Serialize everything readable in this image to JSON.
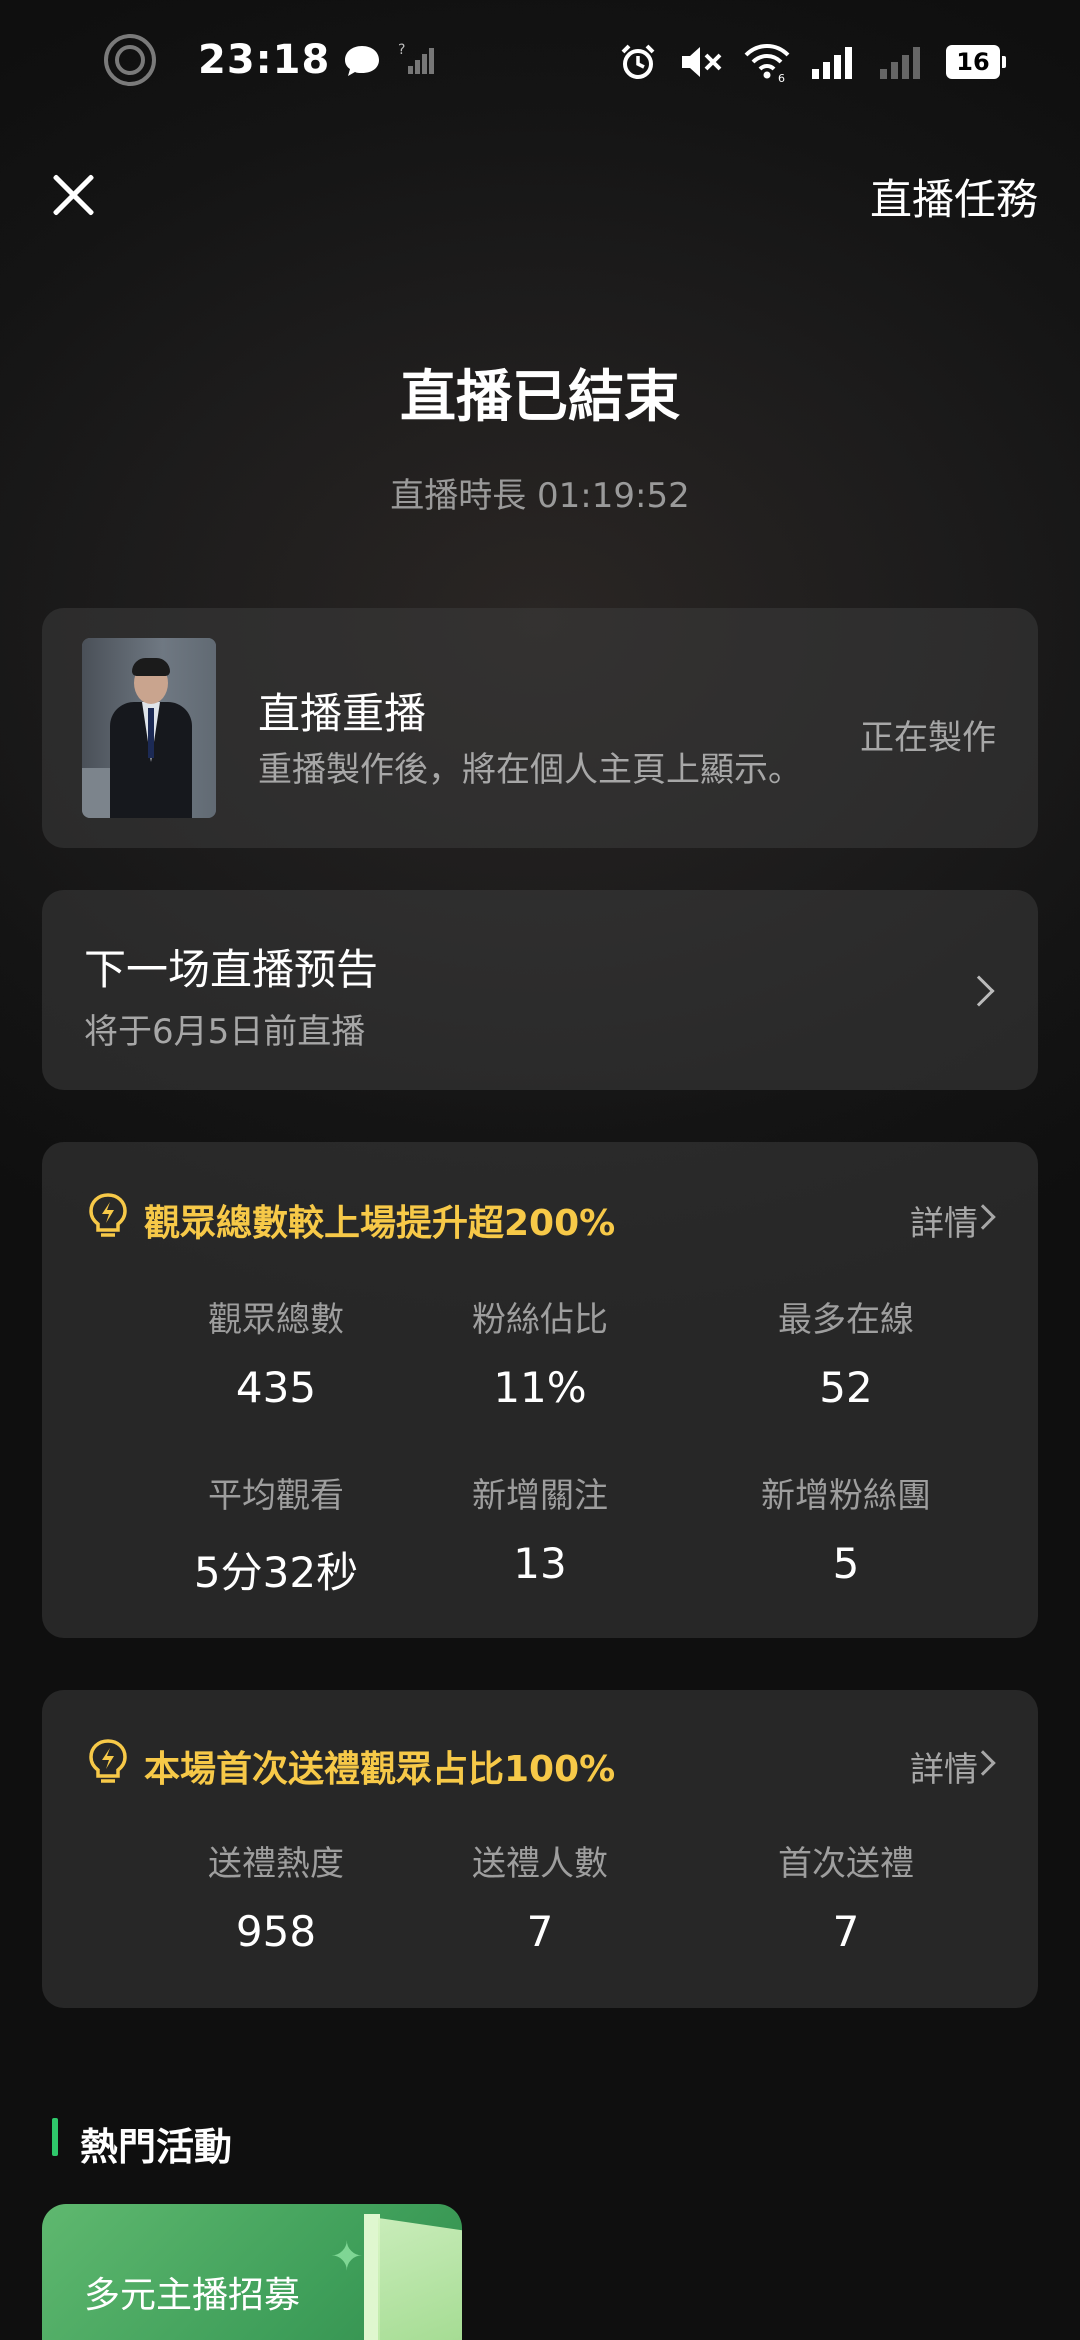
{
  "status_bar": {
    "time": "23:18",
    "battery": "16",
    "icons": [
      "camera-ring-icon",
      "chat-bubble-icon",
      "unknown-signal-icon",
      "alarm-icon",
      "mute-icon",
      "wifi-icon",
      "signal-icon",
      "signal-icon-2",
      "battery-icon"
    ]
  },
  "nav": {
    "close_icon": "close-icon",
    "task_link": "直播任務"
  },
  "header": {
    "title": "直播已結束",
    "duration": "直播時長 01:19:52"
  },
  "replay": {
    "title": "直播重播",
    "subtitle": "重播製作後，將在個人主頁上顯示。",
    "status": "正在製作"
  },
  "next_live": {
    "title": "下一场直播预告",
    "subtitle": "将于6月5日前直播"
  },
  "stats_audience": {
    "headline": "觀眾總數較上場提升超200%",
    "detail_label": "詳情",
    "metrics": [
      {
        "label": "觀眾總數",
        "value": "435"
      },
      {
        "label": "粉絲佔比",
        "value": "11%"
      },
      {
        "label": "最多在線",
        "value": "52"
      },
      {
        "label": "平均觀看",
        "value": "5分32秒"
      },
      {
        "label": "新增關注",
        "value": "13"
      },
      {
        "label": "新增粉絲團",
        "value": "5"
      }
    ]
  },
  "stats_gift": {
    "headline": "本場首次送禮觀眾占比100%",
    "detail_label": "詳情",
    "metrics": [
      {
        "label": "送禮熱度",
        "value": "958"
      },
      {
        "label": "送禮人數",
        "value": "7"
      },
      {
        "label": "首次送禮",
        "value": "7"
      }
    ]
  },
  "hot_activities": {
    "title": "熱門活動",
    "items": [
      {
        "label": "多元主播招募"
      }
    ]
  },
  "colors": {
    "accent_yellow": "#f7c948",
    "accent_green": "#2fc86b",
    "card_bg": "#3c3c3c",
    "text_secondary": "#9e9e9e"
  }
}
